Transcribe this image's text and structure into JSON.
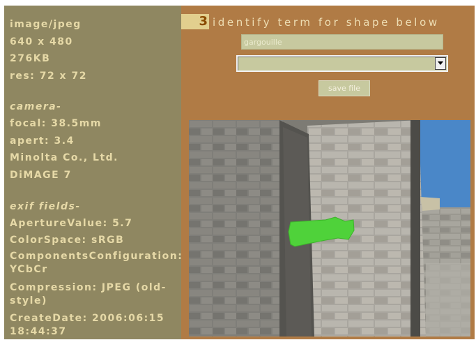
{
  "sidebar": {
    "file_info": [
      "image/jpeg",
      "640 x 480",
      "276KB",
      "res: 72 x 72"
    ],
    "camera_heading": "camera-",
    "camera": [
      "focal: 38.5mm",
      "apert: 3.4",
      "Minolta Co., Ltd.",
      "DiMAGE 7"
    ],
    "exif_heading": "exif fields-",
    "exif": [
      "ApertureValue: 5.7",
      "ColorSpace: sRGB",
      "ComponentsConfiguration: YCbCr",
      "Compression: JPEG (old-style)",
      "CreateDate: 2006:06:15 18:44:37"
    ]
  },
  "task": {
    "step_number": "3",
    "instruction": "identify term for shape below",
    "term_value": "gargouille",
    "select_value": "",
    "save_label": "save file"
  },
  "colors": {
    "sidebar_bg": "#8f8761",
    "sidebar_text": "#e6d9a7",
    "main_bg": "#b07b45",
    "highlight_shape": "#4fd23a"
  }
}
